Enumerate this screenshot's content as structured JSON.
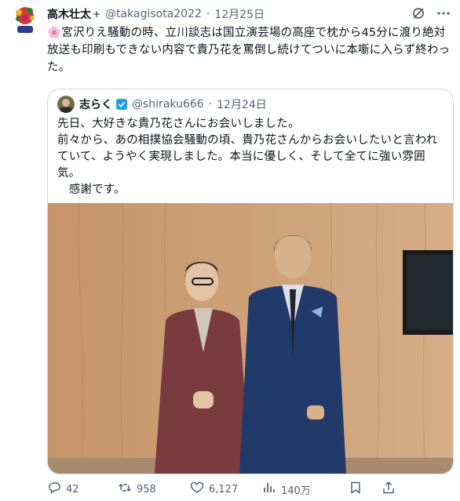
{
  "author": {
    "name": "高木壮太",
    "plus": "+",
    "handle": "@takagisota2022",
    "separator": "·",
    "date": "12月25日"
  },
  "tweet_text": "🌸宮沢りえ騒動の時、立川談志は国立演芸場の高座で枕から45分に渡り絶対放送も印刷もできない内容で貴乃花を罵倒し続けてついに本噺に入らず終わった。",
  "quoted": {
    "name": "志らく",
    "handle": "@shiraku666",
    "separator": "·",
    "date": "12月24日",
    "text": "先日、大好きな貴乃花さんにお会いしました。\n前々から、あの相撲協会騒動の頃、貴乃花さんからお会いしたいと言われていて、ようやく実現しました。本当に優しく、そして全てに強い雰囲気。\n　感謝です。"
  },
  "actions": {
    "replies": "42",
    "retweets": "958",
    "likes": "6,127",
    "views": "140万"
  },
  "colors": {
    "text": "#0f1419",
    "secondary": "#536471",
    "border": "#cfd9de",
    "verified": "#1d9bf0"
  },
  "icons": [
    "grok-icon",
    "more-icon",
    "reply-icon",
    "retweet-icon",
    "like-icon",
    "views-icon",
    "bookmark-icon",
    "share-icon",
    "verified-badge-icon"
  ]
}
